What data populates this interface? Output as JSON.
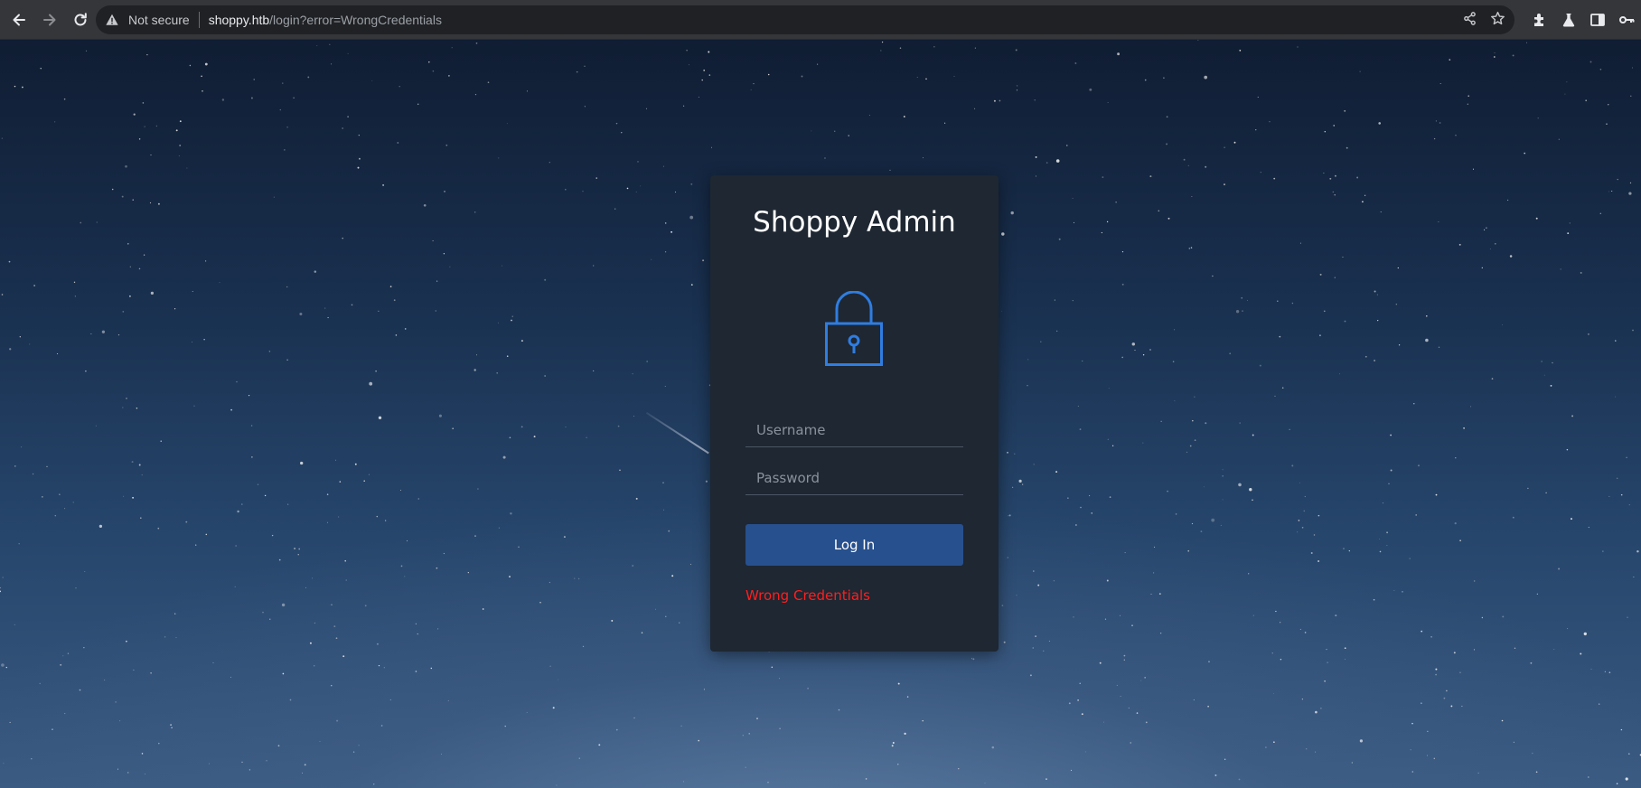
{
  "browser": {
    "security_label": "Not secure",
    "url_host": "shoppy.htb",
    "url_path": "/login?error=WrongCredentials",
    "icons": [
      "back-icon",
      "forward-icon",
      "reload-icon",
      "warning-icon",
      "share-icon",
      "star-icon",
      "extensions-icon",
      "labs-icon",
      "side-panel-icon",
      "key-icon"
    ]
  },
  "login": {
    "title": "Shoppy Admin",
    "username_placeholder": "Username",
    "password_placeholder": "Password",
    "button_label": "Log In",
    "error_message": "Wrong Credentials"
  },
  "colors": {
    "card_bg": "#1e2732",
    "accent": "#2f7de1",
    "button_bg": "#27508e",
    "error": "#ff1f1f"
  }
}
